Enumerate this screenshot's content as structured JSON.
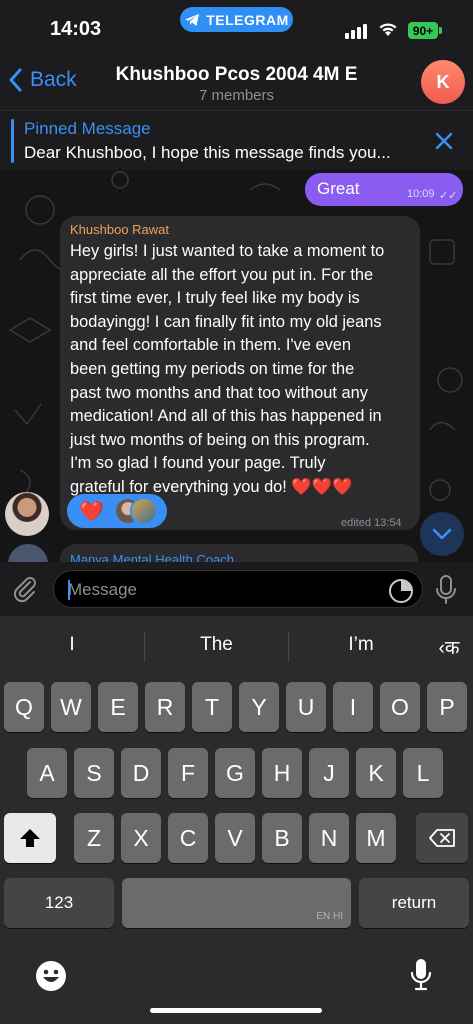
{
  "status_bar": {
    "time": "14:03",
    "app_pill": "TELEGRAM",
    "battery": "90+"
  },
  "header": {
    "back_label": "Back",
    "title": "Khushboo Pcos 2004 4M E",
    "subtitle": "7 members",
    "avatar_letter": "K"
  },
  "pinned": {
    "label": "Pinned Message",
    "text": "Dear Khushboo, I hope this message finds you..."
  },
  "messages": {
    "outgoing": {
      "text": "Great",
      "time": "10:09"
    },
    "incoming": {
      "sender": "Khushboo Rawat",
      "lines": [
        "Hey girls! I just wanted to take a moment to",
        "appreciate all the effort you put in. For the",
        "first time ever, I truly feel like my body is",
        "bodayingg! I can finally fit into my old jeans",
        "and feel comfortable in them. I've even",
        "been getting my periods on time for the",
        "past two months and that too without any",
        "medication! And all of this has happened in",
        "just two months of being on this program.",
        "I'm so glad I found your page. Truly",
        "grateful for everything you do! ❤️❤️❤️"
      ],
      "reaction_emoji": "❤️",
      "time": "edited 13:54"
    },
    "next_sender": "Manya Mental Health Coach"
  },
  "composer": {
    "placeholder": "Message"
  },
  "keyboard": {
    "suggestions": [
      "I",
      "The",
      "I’m"
    ],
    "lang_switch": "‹क",
    "row1": [
      "Q",
      "W",
      "E",
      "R",
      "T",
      "Y",
      "U",
      "I",
      "O",
      "P"
    ],
    "row2": [
      "A",
      "S",
      "D",
      "F",
      "G",
      "H",
      "J",
      "K",
      "L"
    ],
    "row3": [
      "Z",
      "X",
      "C",
      "V",
      "B",
      "N",
      "M"
    ],
    "numbers_label": "123",
    "space_hint": "EN HI",
    "return_label": "return"
  },
  "colors": {
    "accent": "#3a8ff7",
    "outgoing_bubble": "#8a5cf0",
    "incoming_bubble": "#2b2b2e",
    "sender_name": "#f0a35c"
  }
}
